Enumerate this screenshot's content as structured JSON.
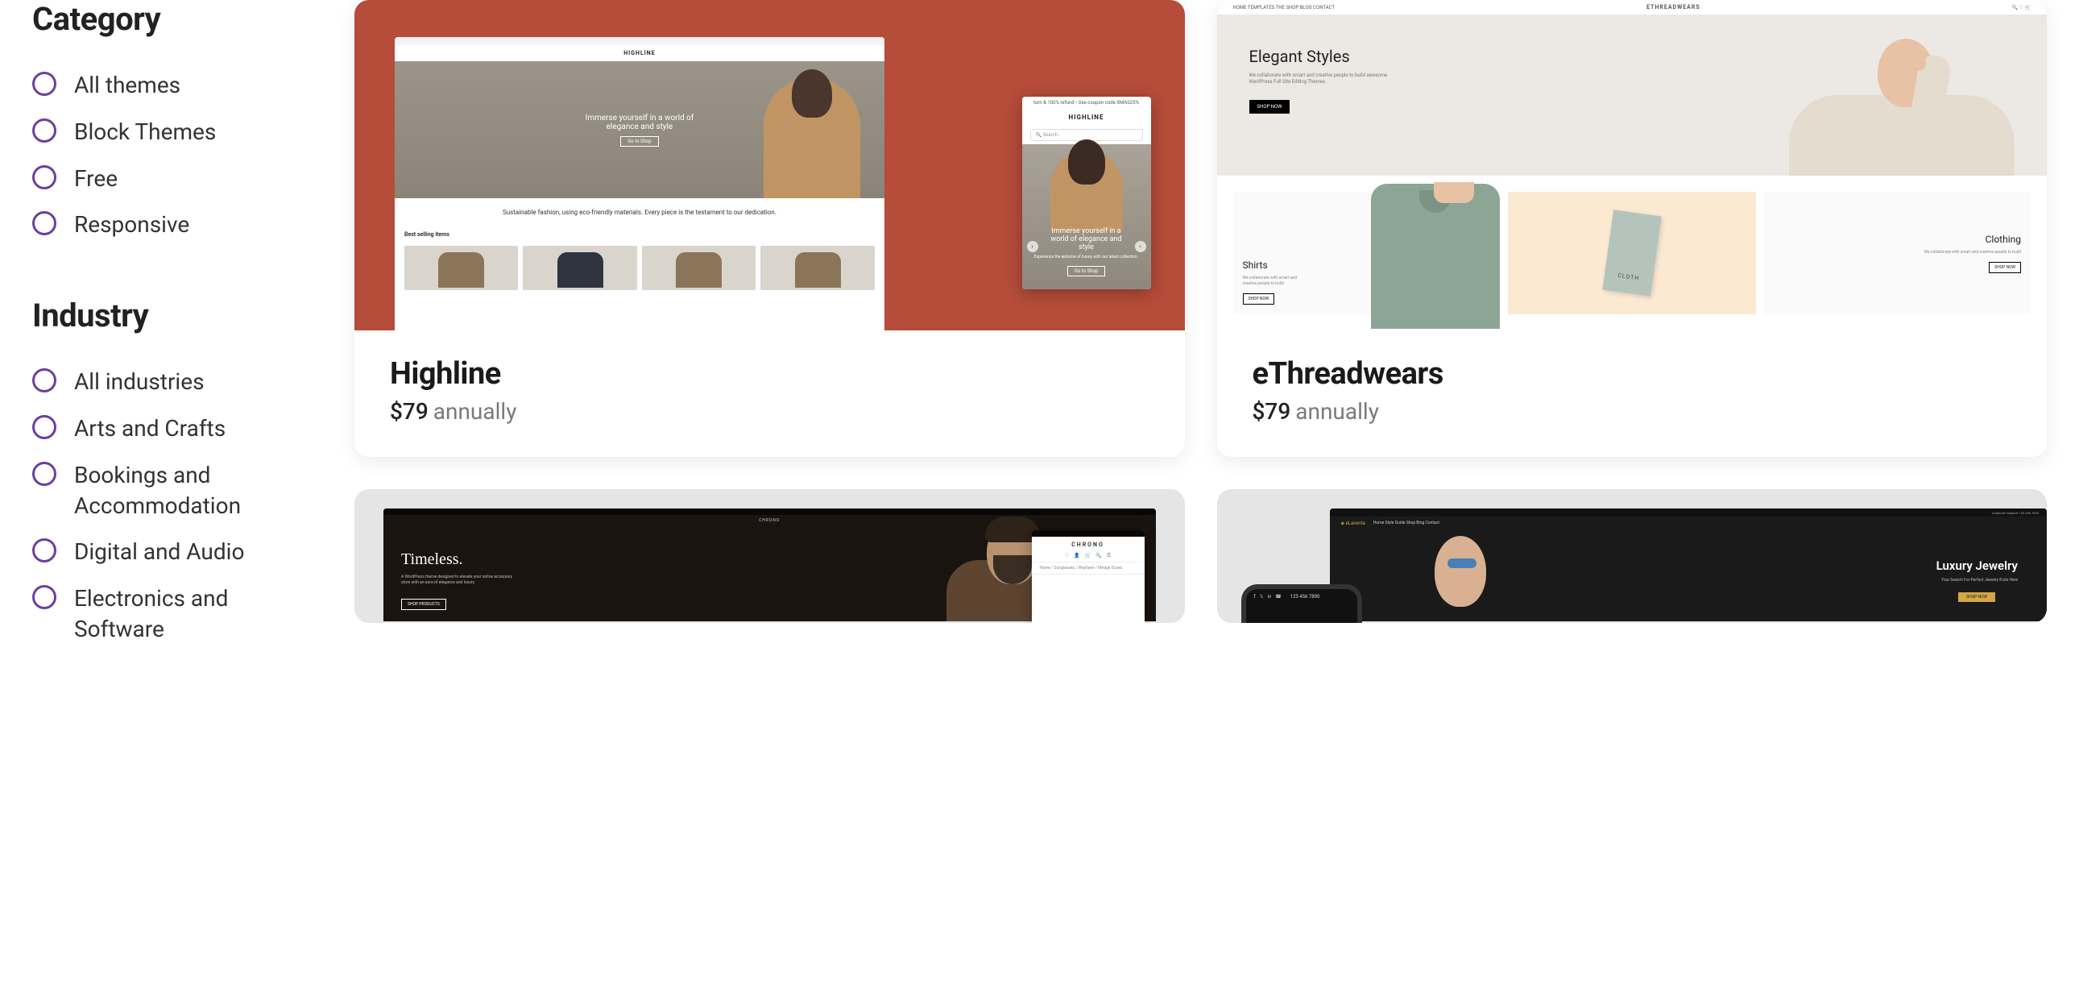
{
  "sidebar": {
    "category_heading": "Category",
    "category_items": [
      {
        "label": "All themes"
      },
      {
        "label": "Block Themes"
      },
      {
        "label": "Free"
      },
      {
        "label": "Responsive"
      }
    ],
    "industry_heading": "Industry",
    "industry_items": [
      {
        "label": "All industries"
      },
      {
        "label": "Arts and Crafts"
      },
      {
        "label": "Bookings and Accommodation"
      },
      {
        "label": "Digital and Audio"
      },
      {
        "label": "Electronics and Software"
      }
    ]
  },
  "themes": [
    {
      "title": "Highline",
      "price": "$79",
      "period": "annually"
    },
    {
      "title": "eThreadwears",
      "price": "$79",
      "period": "annually"
    }
  ],
  "previews": {
    "highline": {
      "brand": "HIGHLINE",
      "hero_line1": "Immerse yourself in a world of",
      "hero_line2": "elegance and style",
      "hero_btn": "Go to Shop",
      "sub_text": "Sustainable fashion, using eco-friendly materials. Every piece is the testament to our dedication.",
      "best": "Best selling items",
      "overlay_topbar": "turn & 100% refund  •  Use coupon code XMAS25%",
      "overlay_brand": "HIGHLINE",
      "overlay_search": "🔍 Search..",
      "overlay_line1": "Immerse yourself in a",
      "overlay_line2": "world of elegance and",
      "overlay_line3": "style",
      "overlay_sub": "Experience the epitome of luxury with our latest collection.",
      "overlay_btn": "Go to Shop"
    },
    "etw": {
      "brand": "ETHREADWEARS",
      "nav": "HOME   TEMPLATES   THE SHOP   BLOG   CONTACT",
      "hero_title": "Elegant Styles",
      "hero_sub": "We collaborate with smart and creative people to build awesome WordPress Full Site Editing Themes",
      "hero_btn": "SHOP NOW",
      "shirts_label": "Shirts",
      "cell_sub": "We collaborate with smart and creative people to build",
      "cell_btn": "SHOP NOW",
      "tag_text": "CLOTH",
      "clothing_label": "Clothing"
    },
    "chrono": {
      "brand": "CHRONO",
      "title": "Timeless.",
      "sub": "A WordPress theme designed to elevate your online accessory store with an aura of elegance and luxury.",
      "btn": "SHOP PRODUCTS",
      "overlay_brand": "CHRONO",
      "overlay_crumb": "Home / Sunglasses / Wayfarer / Mirage Ecoes"
    },
    "elaventa": {
      "top_support": "Customer Support  123 456 7890",
      "logo": "◈ eLaventa",
      "nav": "Home   Style Guide   Shop   Blog   Contact",
      "hero_title": "Luxury Jewelry",
      "hero_sub": "Your Search For Perfect Jewelry Ends Here",
      "hero_btn": "SHOP NOW",
      "phone_num": "123 456 7890"
    }
  }
}
